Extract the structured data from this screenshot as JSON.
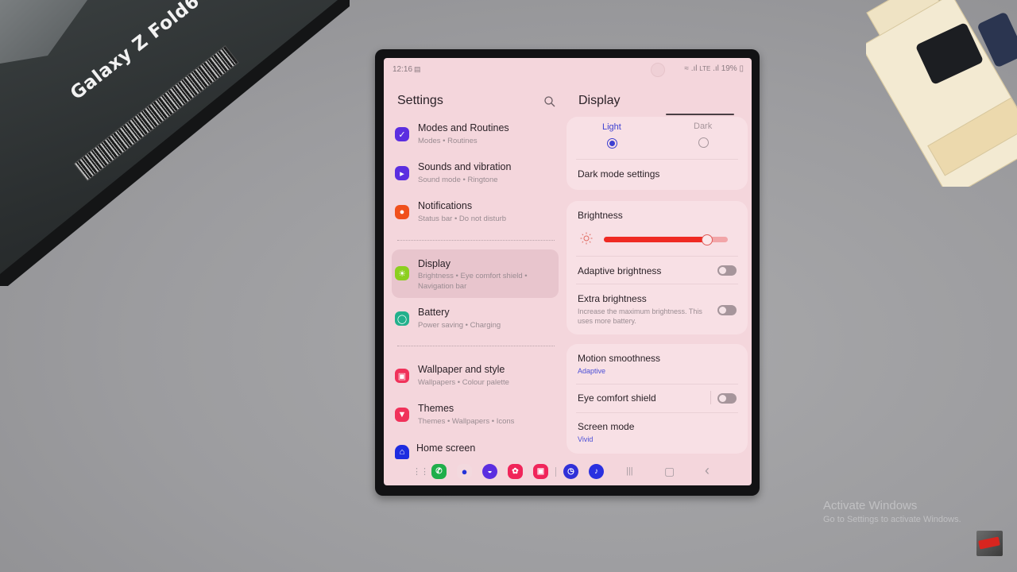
{
  "scene": {
    "box_text": "Galaxy Z Fold6",
    "watermark": {
      "title": "Activate Windows",
      "subtitle": "Go to Settings to activate Windows."
    }
  },
  "status_bar": {
    "time": "12:16",
    "battery": "19%"
  },
  "settings": {
    "title": "Settings",
    "search_icon": "search-icon",
    "items": [
      {
        "label": "Modes and Routines",
        "sub": "Modes  •  Routines",
        "icon": "modes-routines-icon",
        "color": "#5b2ee0"
      },
      {
        "label": "Sounds and vibration",
        "sub": "Sound mode  •  Ringtone",
        "icon": "speaker-icon",
        "color": "#5b2ee0"
      },
      {
        "label": "Notifications",
        "sub": "Status bar  •  Do not disturb",
        "icon": "notification-icon",
        "color": "#f0501c"
      },
      {
        "label": "Display",
        "sub": "Brightness  •  Eye comfort shield  •  Navigation bar",
        "icon": "brightness-icon",
        "color": "#8ccf1f",
        "selected": true
      },
      {
        "label": "Battery",
        "sub": "Power saving  •  Charging",
        "icon": "battery-icon",
        "color": "#22b08c"
      },
      {
        "label": "Wallpaper and style",
        "sub": "Wallpapers  •  Colour palette",
        "icon": "wallpaper-icon",
        "color": "#f0325a"
      },
      {
        "label": "Themes",
        "sub": "Themes  •  Wallpapers  •  Icons",
        "icon": "themes-icon",
        "color": "#f0325a"
      },
      {
        "label": "Home screen",
        "sub": "",
        "icon": "home-icon",
        "color": "#1e2ce0"
      }
    ]
  },
  "display": {
    "title": "Display",
    "theme_options": [
      {
        "label": "Light",
        "selected": true
      },
      {
        "label": "Dark",
        "selected": false
      }
    ],
    "dark_mode_settings": "Dark mode settings",
    "brightness": {
      "label": "Brightness",
      "value_percent": 83
    },
    "adaptive_brightness": {
      "label": "Adaptive brightness",
      "on": false
    },
    "extra_brightness": {
      "label": "Extra brightness",
      "sub": "Increase the maximum brightness. This uses more battery.",
      "on": false
    },
    "motion_smoothness": {
      "label": "Motion smoothness",
      "value": "Adaptive"
    },
    "eye_comfort_shield": {
      "label": "Eye comfort shield",
      "on": false
    },
    "screen_mode": {
      "label": "Screen mode",
      "value": "Vivid"
    }
  },
  "taskbar": {
    "apps": [
      {
        "name": "phone-app-icon",
        "color": "#1fae4a",
        "glyph": "✆"
      },
      {
        "name": "messages-app-icon",
        "color": "#f3d9de",
        "glyph": "●"
      },
      {
        "name": "internet-app-icon",
        "color": "#5b2ee0",
        "glyph": "◒"
      },
      {
        "name": "bixby-app-icon",
        "color": "#f0255a",
        "glyph": "✿"
      },
      {
        "name": "camera-app-icon",
        "color": "#f0255a",
        "glyph": "▣"
      },
      {
        "name": "clock-app-icon",
        "color": "#3030d8",
        "glyph": "◷"
      },
      {
        "name": "music-app-icon",
        "color": "#2a30e0",
        "glyph": "♪"
      }
    ],
    "recents_glyph": "|||",
    "home_glyph": "▢",
    "back_glyph": "‹"
  }
}
